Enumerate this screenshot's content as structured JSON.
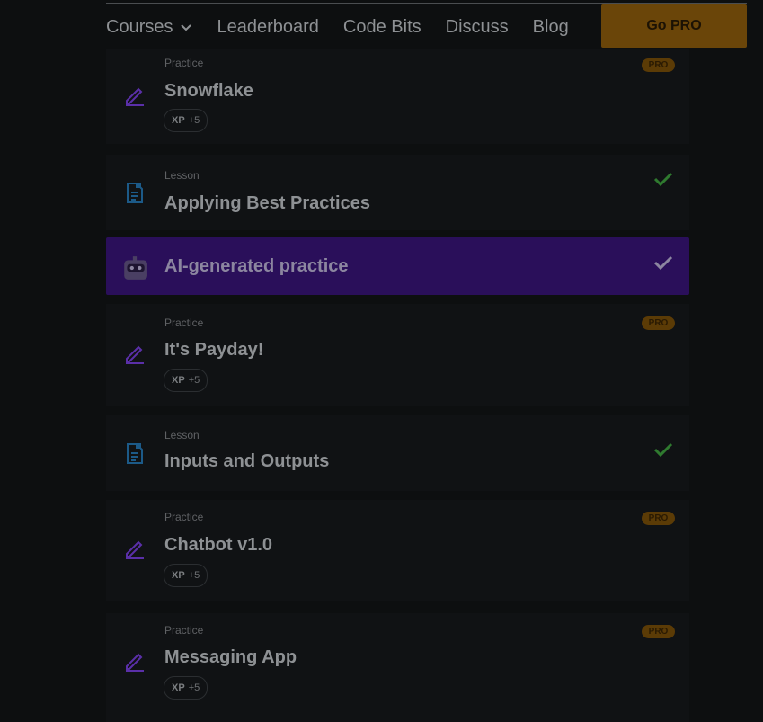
{
  "nav": {
    "links": [
      "Courses",
      "Leaderboard",
      "Code Bits",
      "Discuss",
      "Blog"
    ],
    "go_pro": "Go PRO"
  },
  "items": [
    {
      "kind": "Practice",
      "title": "Snowflake",
      "xp_label": "XP",
      "xp_value": "+5",
      "badge": "PRO"
    },
    {
      "kind": "Lesson",
      "title": "Applying Best Practices"
    },
    {
      "title": "AI-generated practice"
    },
    {
      "kind": "Practice",
      "title": "It's Payday!",
      "xp_label": "XP",
      "xp_value": "+5",
      "badge": "PRO"
    },
    {
      "kind": "Lesson",
      "title": "Inputs and Outputs"
    },
    {
      "kind": "Practice",
      "title": "Chatbot v1.0",
      "xp_label": "XP",
      "xp_value": "+5",
      "badge": "PRO"
    },
    {
      "kind": "Practice",
      "title": "Messaging App",
      "xp_label": "XP",
      "xp_value": "+5",
      "badge": "PRO"
    }
  ],
  "icons": {
    "practice": "pencil-icon",
    "lesson": "document-icon",
    "ai": "robot-icon",
    "check": "checkmark-icon",
    "courses_dropdown": "chevron-down-icon"
  },
  "colors": {
    "background": "#0d0f10",
    "accent_pro": "#6a4509",
    "ai_highlight": "#2a0f5a",
    "practice_icon": "#5a2fa8",
    "lesson_icon": "#1c5a88",
    "check_green": "#2f7a2f"
  }
}
